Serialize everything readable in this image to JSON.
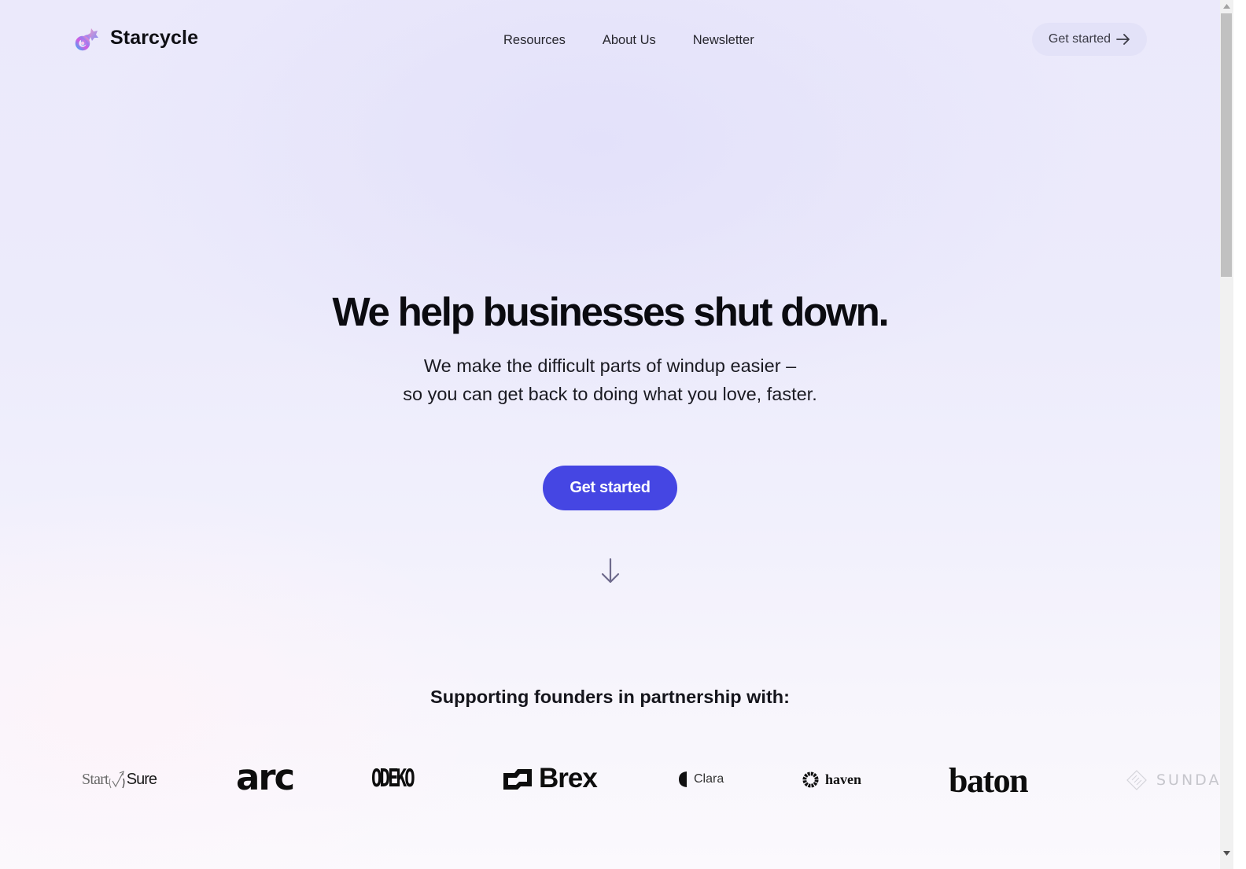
{
  "brand": {
    "name": "Starcycle",
    "logo_icon": "starcycle-logo-icon"
  },
  "nav": {
    "items": [
      {
        "label": "Resources"
      },
      {
        "label": "About Us"
      },
      {
        "label": "Newsletter"
      }
    ],
    "cta_label": "Get started",
    "cta_icon": "arrow-right-icon"
  },
  "hero": {
    "title": "We help businesses shut down.",
    "subtitle_line1": "We make the difficult parts of windup easier –",
    "subtitle_line2": "so you can get back to doing what you love, faster.",
    "cta_label": "Get started",
    "scroll_icon": "arrow-down-icon",
    "cta_color": "#4546e3"
  },
  "partners": {
    "title": "Supporting founders in partnership with:",
    "logos": [
      {
        "name": "StartSure",
        "text_a": "Start",
        "text_b": "Sure"
      },
      {
        "name": "arc",
        "text": "arc"
      },
      {
        "name": "ODEKO",
        "text": "ODEKO"
      },
      {
        "name": "Brex",
        "text": "Brex"
      },
      {
        "name": "Clara",
        "text": "Clara"
      },
      {
        "name": "haven",
        "text": "haven"
      },
      {
        "name": "baton",
        "text": "baton"
      },
      {
        "name": "SUNDAY",
        "text": "SUNDA"
      }
    ]
  },
  "colors": {
    "accent": "#4546e3",
    "background_top": "#ebe9fb",
    "background_bottom": "#fbf9fd",
    "text": "#0b0b10"
  },
  "scrollbar": {
    "position_fraction": 0.0
  }
}
